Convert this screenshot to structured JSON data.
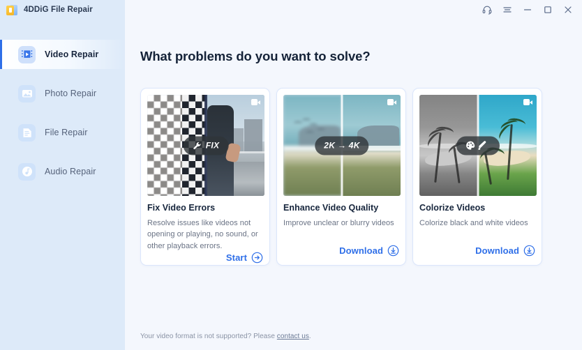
{
  "window": {
    "title": "4DDiG File Repair",
    "app_icon": "app-document-icon",
    "controls": [
      {
        "name": "support-headset-icon",
        "label": "Support"
      },
      {
        "name": "menu-icon",
        "label": "Menu"
      },
      {
        "name": "minimize-icon",
        "label": "Minimize"
      },
      {
        "name": "maximize-icon",
        "label": "Maximize"
      },
      {
        "name": "close-icon",
        "label": "Close"
      }
    ]
  },
  "sidebar": {
    "items": [
      {
        "label": "Video Repair",
        "icon": "video-repair-icon",
        "active": true
      },
      {
        "label": "Photo Repair",
        "icon": "photo-repair-icon",
        "active": false
      },
      {
        "label": "File Repair",
        "icon": "file-repair-icon",
        "active": false
      },
      {
        "label": "Audio Repair",
        "icon": "audio-repair-icon",
        "active": false
      }
    ]
  },
  "main": {
    "title": "What problems do you want to solve?",
    "cards": [
      {
        "title": "Fix Video Errors",
        "desc": "Resolve issues like videos not opening or playing, no sound, or other playback errors.",
        "badge": "FIX",
        "badge_icon": "wrench-icon",
        "action_label": "Start",
        "action_icon": "arrow-right-circle-icon",
        "thumb_icon": "video-camera-icon"
      },
      {
        "title": "Enhance Video Quality",
        "desc": "Improve unclear or blurry videos",
        "badge": "2K → 4K",
        "badge_icon": "",
        "action_label": "Download",
        "action_icon": "download-circle-icon",
        "thumb_icon": "video-camera-icon"
      },
      {
        "title": "Colorize Videos",
        "desc": "Colorize black and white videos",
        "badge": "",
        "badge_icon": "palette-brush-icon",
        "action_label": "Download",
        "action_icon": "download-circle-icon",
        "thumb_icon": "video-camera-icon"
      }
    ],
    "footer": {
      "text": "Your video format is not supported? Please ",
      "link": "contact us",
      "suffix": "."
    }
  },
  "colors": {
    "accent": "#2f6fe8",
    "sidebar_bg": "#ddeaf9",
    "main_bg": "#f4f7fd",
    "card_border": "#dbe6fb",
    "title_text": "#152338"
  }
}
